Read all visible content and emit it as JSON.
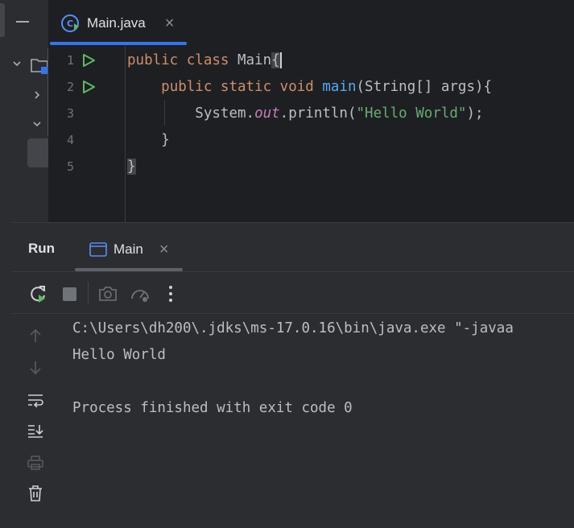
{
  "editor": {
    "tab": {
      "label": "Main.java",
      "close": "×"
    },
    "line_numbers": [
      "1",
      "2",
      "3",
      "4",
      "5"
    ],
    "code": {
      "l1_kw": "public class ",
      "l1_name": "Main",
      "l1_brace": "{",
      "l2_indent": "    ",
      "l2_kw": "public static void ",
      "l2_fn": "main",
      "l2_rest": "(String[] args){",
      "l3_indent": "        ",
      "l3_a": "System.",
      "l3_field": "out",
      "l3_b": ".println(",
      "l3_str": "\"Hello World\"",
      "l3_c": ");",
      "l4": "    }",
      "l5": "}"
    }
  },
  "run_panel": {
    "title": "Run",
    "tab": {
      "label": "Main",
      "close": "×"
    },
    "console_lines": [
      "C:\\Users\\dh200\\.jdks\\ms-17.0.16\\bin\\java.exe \"-javaa",
      "Hello World",
      "",
      "Process finished with exit code 0"
    ]
  },
  "colors": {
    "keyword": "#cf8e6d",
    "function": "#56a8f5",
    "string": "#6aab73",
    "field": "#c77dba",
    "accent": "#3574f0",
    "run_green": "#5fb865"
  }
}
